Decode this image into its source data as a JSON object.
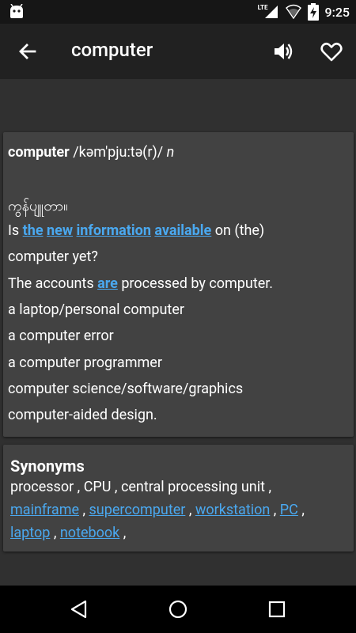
{
  "status_bar": {
    "network": "LTE",
    "battery_icon": "battery-charging-icon",
    "time": "9:25"
  },
  "app_bar": {
    "title": "computer",
    "icons": [
      "back-arrow-icon",
      "speaker-icon",
      "heart-icon"
    ]
  },
  "definition": {
    "word": "computer",
    "pronunciation": "/kəm'pju:tə(r)/",
    "pos": "n",
    "translation": "ကွန်ပျူတာ။",
    "examples": [
      {
        "segments": [
          {
            "text": "Is ",
            "link": false
          },
          {
            "text": "the",
            "link": true
          },
          {
            "text": " ",
            "link": false
          },
          {
            "text": "new",
            "link": true
          },
          {
            "text": " ",
            "link": false
          },
          {
            "text": "information",
            "link": true
          },
          {
            "text": " ",
            "link": false
          },
          {
            "text": "available",
            "link": true
          },
          {
            "text": " on (the)",
            "link": false
          }
        ]
      },
      {
        "segments": [
          {
            "text": "computer yet?",
            "link": false
          }
        ]
      },
      {
        "segments": [
          {
            "text": "The accounts ",
            "link": false
          },
          {
            "text": "are",
            "link": true
          },
          {
            "text": " processed by computer.",
            "link": false
          }
        ]
      },
      {
        "segments": [
          {
            "text": "a laptop/personal computer",
            "link": false
          }
        ]
      },
      {
        "segments": [
          {
            "text": "a computer error",
            "link": false
          }
        ]
      },
      {
        "segments": [
          {
            "text": "a computer programmer",
            "link": false
          }
        ]
      },
      {
        "segments": [
          {
            "text": "computer science/software/graphics",
            "link": false
          }
        ]
      },
      {
        "segments": [
          {
            "text": "computer-aided design.",
            "link": false
          }
        ]
      }
    ]
  },
  "synonyms": {
    "title": "Synonyms",
    "lines": [
      [
        {
          "text": "processor",
          "link": false
        },
        {
          "text": " , ",
          "link": false
        },
        {
          "text": "CPU",
          "link": false
        },
        {
          "text": " , ",
          "link": false
        },
        {
          "text": "central processing unit",
          "link": false
        },
        {
          "text": " ,",
          "link": false
        }
      ],
      [
        {
          "text": "mainframe",
          "link": true
        },
        {
          "text": " , ",
          "link": false
        },
        {
          "text": "supercomputer",
          "link": true
        },
        {
          "text": " , ",
          "link": false
        },
        {
          "text": "workstation",
          "link": true
        },
        {
          "text": " , ",
          "link": false
        },
        {
          "text": "PC",
          "link": true
        },
        {
          "text": " ,",
          "link": false
        }
      ],
      [
        {
          "text": "laptop",
          "link": true
        },
        {
          "text": " , ",
          "link": false
        },
        {
          "text": "notebook",
          "link": true
        },
        {
          "text": " ,",
          "link": false
        }
      ]
    ]
  },
  "nav_bar": {
    "icons": [
      "back-triangle-icon",
      "home-circle-icon",
      "recents-square-icon"
    ]
  },
  "colors": {
    "background": "#303030",
    "card": "#424242",
    "app_bar": "#212121",
    "status_bar": "#161616",
    "link": "#4aa8ef"
  }
}
